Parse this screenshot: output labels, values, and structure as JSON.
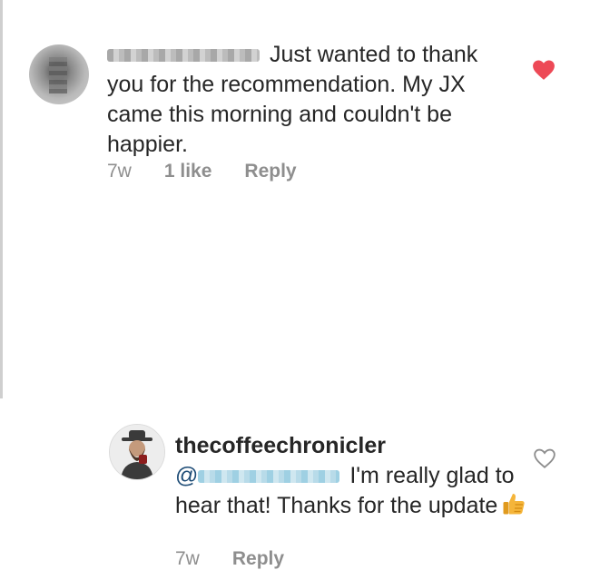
{
  "comments": [
    {
      "author_redacted": true,
      "text": "Just wanted to thank you for the recommendation. My JX came this morning and couldn't be happier.",
      "time": "7w",
      "likes": "1 like",
      "reply_label": "Reply",
      "liked": true
    },
    {
      "author": "thecoffeechronicler",
      "mention_prefix": "@",
      "text": "I'm really glad to hear that! Thanks for the update",
      "emoji": "thumbs-up",
      "time": "7w",
      "reply_label": "Reply",
      "liked": false
    }
  ],
  "colors": {
    "text": "#262626",
    "meta": "#8e8e8e",
    "heart_liked": "#ed4956",
    "heart_outline": "#8e8e8e",
    "mention": "#1f4d77"
  }
}
